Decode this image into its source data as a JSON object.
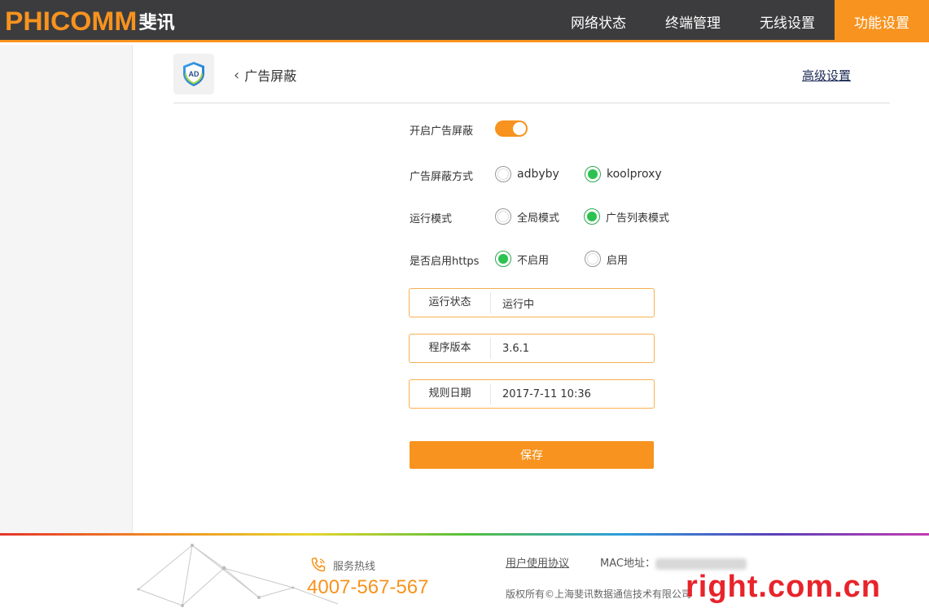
{
  "header": {
    "logo_en": "PHICOMM",
    "logo_cn": "斐讯",
    "nav": [
      {
        "label": "网络状态",
        "active": false
      },
      {
        "label": "终端管理",
        "active": false
      },
      {
        "label": "无线设置",
        "active": false
      },
      {
        "label": "功能设置",
        "active": true
      }
    ]
  },
  "page": {
    "app_icon_text": "AD",
    "back_label": "广告屏蔽",
    "advanced_link": "高级设置"
  },
  "form": {
    "enable_label": "开启广告屏蔽",
    "enable_on": true,
    "method_label": "广告屏蔽方式",
    "method_options": [
      {
        "label": "adbyby",
        "checked": false
      },
      {
        "label": "koolproxy",
        "checked": true
      }
    ],
    "mode_label": "运行模式",
    "mode_options": [
      {
        "label": "全局模式",
        "checked": false
      },
      {
        "label": "广告列表模式",
        "checked": true
      }
    ],
    "https_label": "是否启用https",
    "https_options": [
      {
        "label": "不启用",
        "checked": true
      },
      {
        "label": "启用",
        "checked": false
      }
    ],
    "status": {
      "key": "运行状态",
      "value": "运行中"
    },
    "version": {
      "key": "程序版本",
      "value": "3.6.1"
    },
    "rule_date": {
      "key": "规则日期",
      "value": "2017-7-11 10:36"
    },
    "save_label": "保存"
  },
  "footer": {
    "hotline_label": "服务热线",
    "hotline_number": "4007-567-567",
    "agreement": "用户使用协议",
    "mac_label": "MAC地址：",
    "copyright": "版权所有©上海斐讯数据通信技术有限公司",
    "watermark": "right.com.cn"
  },
  "colors": {
    "accent": "#f7931e",
    "header_bg": "#3c3c3e",
    "radio_checked": "#2bc250"
  }
}
